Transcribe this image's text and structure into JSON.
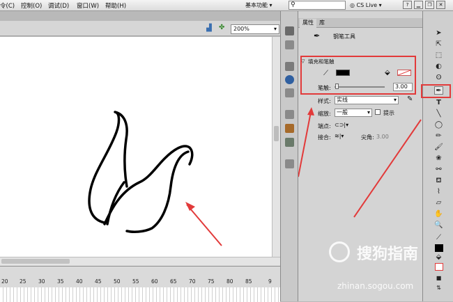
{
  "menubar": {
    "items": [
      "令(C)",
      "控制(O)",
      "调试(D)",
      "窗口(W)",
      "帮助(H)"
    ],
    "workspace": "基本功能",
    "cs_live": "CS Live"
  },
  "doc": {
    "zoom": "200%"
  },
  "timeline": {
    "ticks": [
      "20",
      "25",
      "30",
      "35",
      "40",
      "45",
      "50",
      "55",
      "60",
      "65",
      "70",
      "75",
      "80",
      "85",
      "9"
    ]
  },
  "panel": {
    "tabs": [
      "属性",
      "库"
    ],
    "tool_name": "钢笔工具",
    "section_fill_stroke": "填充和笔触",
    "stroke_label": "笔触:",
    "stroke_value": "3.00",
    "style_label": "样式:",
    "style_value": "实线",
    "scale_label": "缩放:",
    "scale_value": "一般",
    "hint_label": "提示",
    "cap_label": "端点:",
    "join_label": "接合:",
    "miter_label": "尖角:",
    "miter_value": "3.00"
  },
  "colors": {
    "stroke_swatch": "#000000",
    "highlight": "#e23a3a"
  },
  "watermark": {
    "text": "搜狗指南",
    "url": "zhinan.sogou.com"
  }
}
